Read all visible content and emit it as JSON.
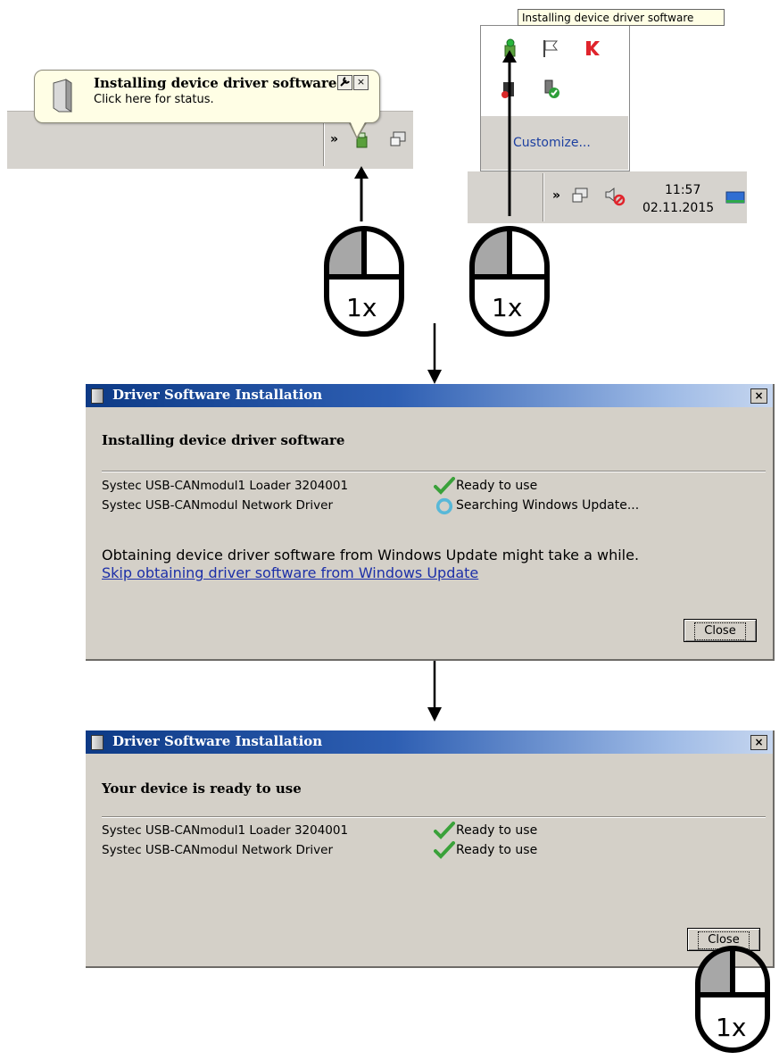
{
  "balloon": {
    "title": "Installing device driver software",
    "text": "Click here for status.",
    "options_icon": "wrench-icon",
    "close_label": "×"
  },
  "tray_left": {
    "chevron": "»",
    "icons": [
      "driver-install-icon",
      "network-icon"
    ]
  },
  "tray_popup": {
    "tooltip": "Installing device driver software",
    "icons": [
      "driver-install-icon",
      "action-center-flag-icon",
      "antivirus-icon",
      "remove-hardware-icon",
      "safely-remove-icon"
    ],
    "customize_label": "Customize..."
  },
  "tray_right": {
    "chevron": "»",
    "time": "11:57",
    "date": "02.11.2015",
    "icons": [
      "network-icon",
      "volume-muted-icon",
      "show-desktop-icon"
    ]
  },
  "clicks": {
    "label": "1x"
  },
  "dialog1": {
    "title": "Driver Software Installation",
    "close_label": "×",
    "heading": "Installing device driver software",
    "devices": [
      {
        "name": "Systec USB-CANmodul1 Loader 3204001",
        "status": "Ready to use",
        "icon": "check-icon"
      },
      {
        "name": "Systec USB-CANmodul Network Driver",
        "status": "Searching Windows Update...",
        "icon": "searching-icon"
      }
    ],
    "info": "Obtaining device driver software from Windows Update might take a while.",
    "link": "Skip obtaining driver software from Windows Update",
    "button_label": "Close"
  },
  "dialog2": {
    "title": "Driver Software Installation",
    "close_label": "×",
    "heading": "Your device is ready to use",
    "devices": [
      {
        "name": "Systec USB-CANmodul1 Loader 3204001",
        "status": "Ready to use",
        "icon": "check-icon"
      },
      {
        "name": "Systec USB-CANmodul Network Driver",
        "status": "Ready to use",
        "icon": "check-icon"
      }
    ],
    "button_label": "Close"
  }
}
